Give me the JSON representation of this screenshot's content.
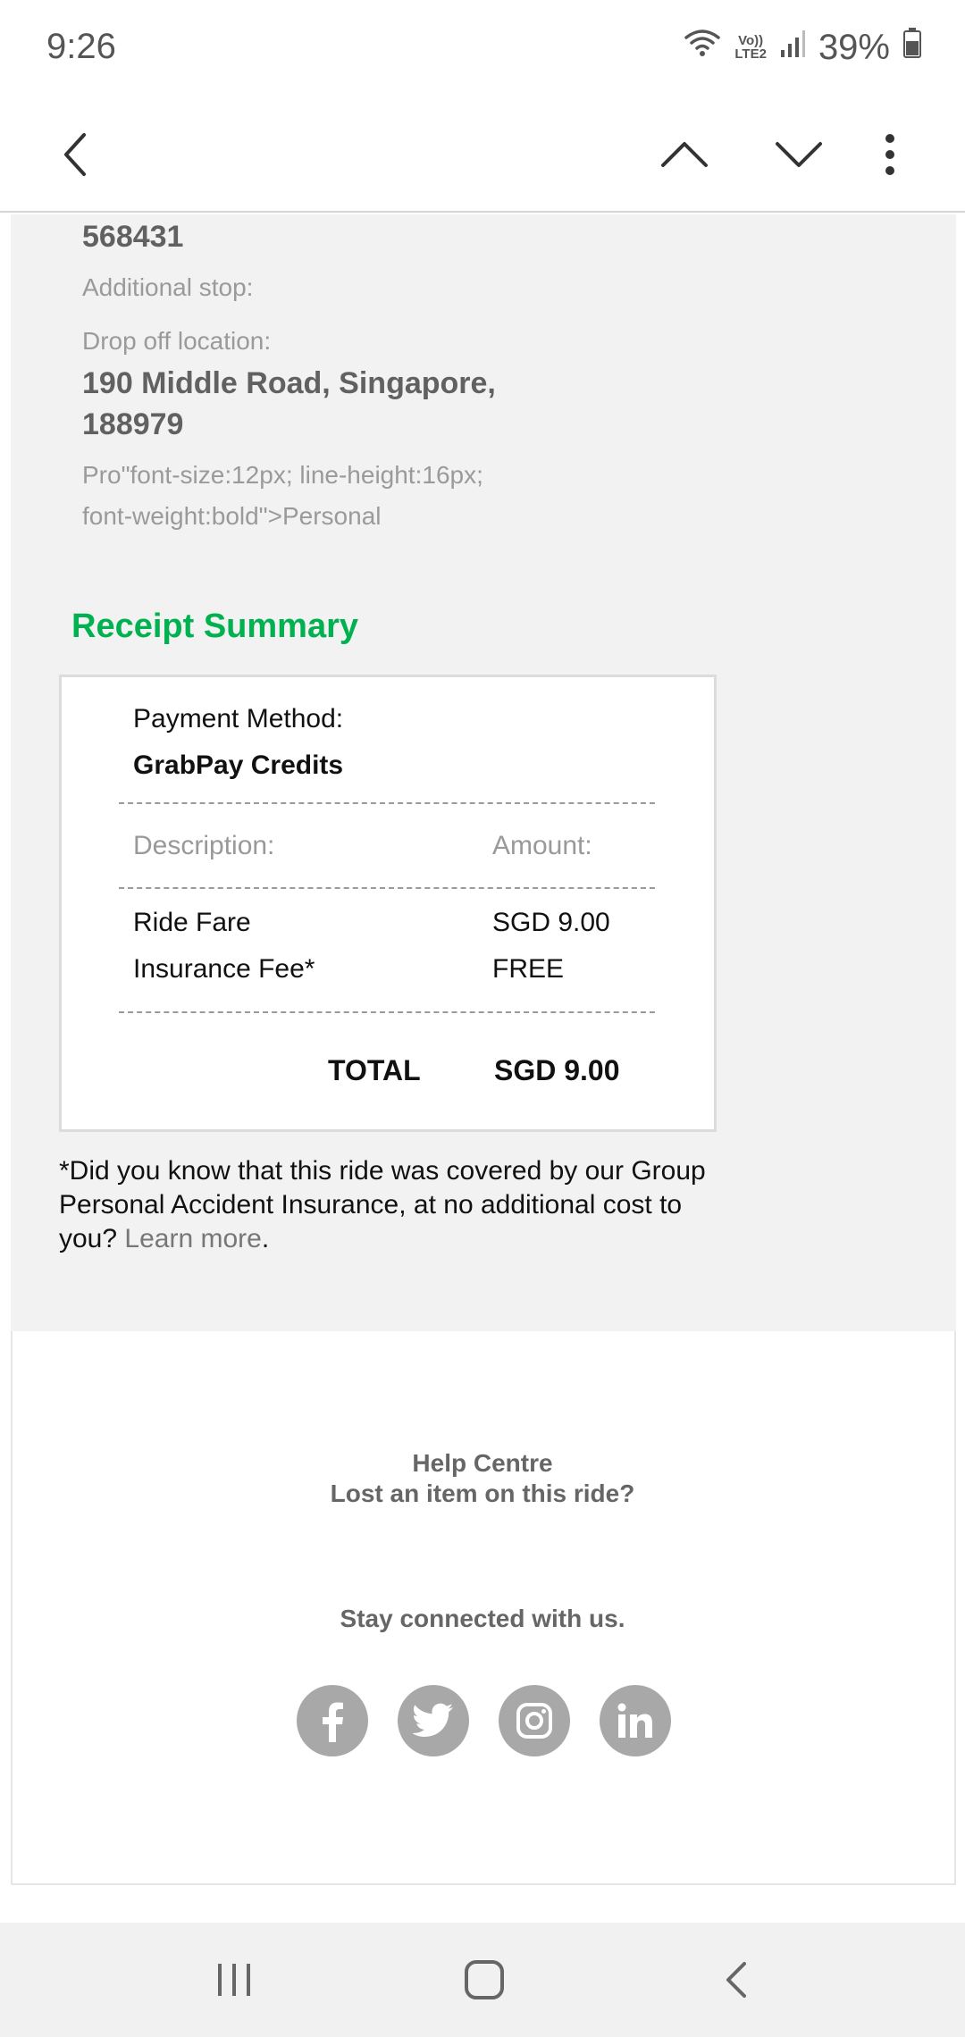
{
  "status_bar": {
    "time": "9:26",
    "network_top": "Vo))",
    "network_bottom": "LTE2",
    "battery": "39%"
  },
  "app_bar": {
    "icons": [
      "back-arrow-icon",
      "previous-chevron-up-icon",
      "next-chevron-down-icon",
      "more-options-icon"
    ]
  },
  "trip": {
    "pickup_tail": "568431",
    "additional_stop_label": "Additional stop:",
    "dropoff_label": "Drop off location:",
    "dropoff_line1": "190 Middle Road, Singapore,",
    "dropoff_line2": "188979",
    "profile_line1": "Pro\"font-size:12px; line-height:16px;",
    "profile_line2": "font-weight:bold\">Personal"
  },
  "receipt": {
    "title": "Receipt Summary",
    "payment_method_label": "Payment Method:",
    "payment_method_value": "GrabPay Credits",
    "description_header": "Description:",
    "amount_header": "Amount:",
    "items": [
      {
        "description": "Ride Fare",
        "amount": "SGD 9.00"
      },
      {
        "description": "Insurance Fee*",
        "amount": "FREE"
      }
    ],
    "total_label": "TOTAL",
    "total_value": "SGD 9.00"
  },
  "note": {
    "text": "*Did you know that this ride was covered by our Group Personal Accident Insurance, at no additional cost to you?",
    "link": "Learn more",
    "suffix": "."
  },
  "footer": {
    "help_centre": "Help Centre",
    "lost_item": "Lost an item on this ride?",
    "stay_connected": "Stay connected with us.",
    "social": [
      "facebook-icon",
      "twitter-icon",
      "instagram-icon",
      "linkedin-icon"
    ]
  },
  "nav_bar": {
    "icons": [
      "recent-apps-icon",
      "home-icon",
      "back-icon"
    ]
  },
  "colors": {
    "accent": "#00b14f",
    "content_bg": "#f2f2f2",
    "social_bg": "#a8a8a8"
  }
}
